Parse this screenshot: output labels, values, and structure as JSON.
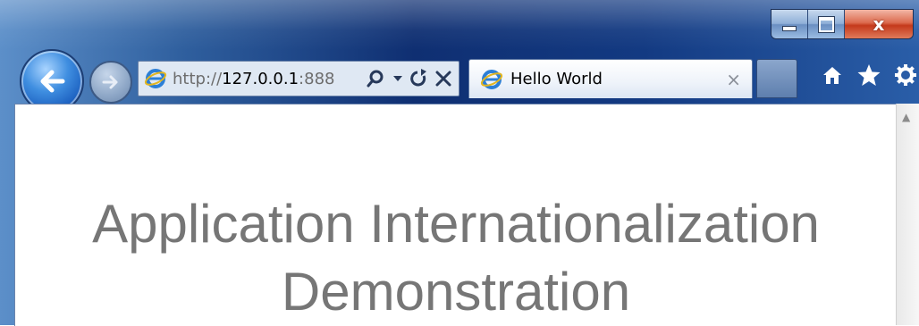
{
  "window": {
    "caption_buttons": {
      "minimize_icon": "minimize-icon",
      "maximize_icon": "maximize-icon",
      "close_label": "x"
    }
  },
  "toolbar": {
    "back_icon": "back-arrow-icon",
    "forward_icon": "forward-arrow-icon",
    "address": {
      "scheme": "http://",
      "host": "127.0.0.1",
      "port_fragment": ":888",
      "search_icon": "search-icon",
      "dropdown_icon": "chevron-down-icon",
      "refresh_icon": "refresh-icon",
      "stop_icon": "stop-icon"
    },
    "tab": {
      "title": "Hello World",
      "close_label": "×"
    },
    "right_icons": [
      "home-icon",
      "favorites-star-icon",
      "gear-icon"
    ]
  },
  "page": {
    "heading_line1": "Application Internationalization",
    "heading_line2": "Demonstration"
  },
  "colors": {
    "heading_text": "#767676",
    "frame_dark": "#0f2f72",
    "close_button": "#c4391b"
  }
}
